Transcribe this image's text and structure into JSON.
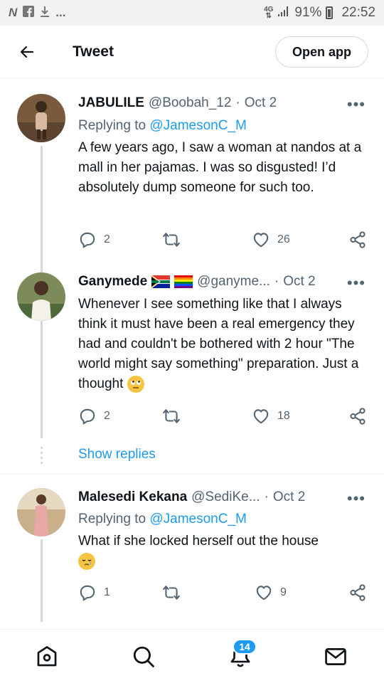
{
  "status_bar": {
    "left_icons": [
      "n-icon",
      "facebook-icon",
      "download-icon",
      "more-dots"
    ],
    "left_text": "N",
    "ellipsis": "...",
    "network_top": "4G",
    "network_bottom": "⇅",
    "battery_percent": "91%",
    "time": "22:52"
  },
  "header": {
    "title": "Tweet",
    "open_app_label": "Open app"
  },
  "tweets": [
    {
      "name": "JABULILE",
      "handle": "@Boobah_12",
      "date": "Oct 2",
      "replying_label": "Replying to ",
      "replying_to": "@JamesonC_M",
      "text": "A few years ago, I saw a woman at nandos at a mall in her pajamas. I was so disgusted! I’d absolutely dump someone for such too.",
      "replies": "2",
      "retweets": "",
      "likes": "26"
    },
    {
      "name": "Ganymede",
      "handle": "@ganyme...",
      "date": "Oct 2",
      "text": "Whenever I see something like that I always think it must have been a real emergency they had and couldn't be bothered with 2 hour \"The world might say something\" preparation. Just a thought",
      "replies": "2",
      "retweets": "",
      "likes": "18"
    },
    {
      "name": "Malesedi Kekana",
      "handle": "@SediKe...",
      "date": "Oct 2",
      "replying_label": "Replying to ",
      "replying_to": "@JamesonC_M",
      "text": "What if she locked herself out the house",
      "replies": "1",
      "retweets": "",
      "likes": "9"
    }
  ],
  "show_replies_label": "Show replies",
  "separator": "·",
  "bottom_nav": {
    "notifications_badge": "14"
  },
  "colors": {
    "accent": "#1d9bf0",
    "secondary_text": "#536471",
    "primary_text": "#0f1419"
  }
}
